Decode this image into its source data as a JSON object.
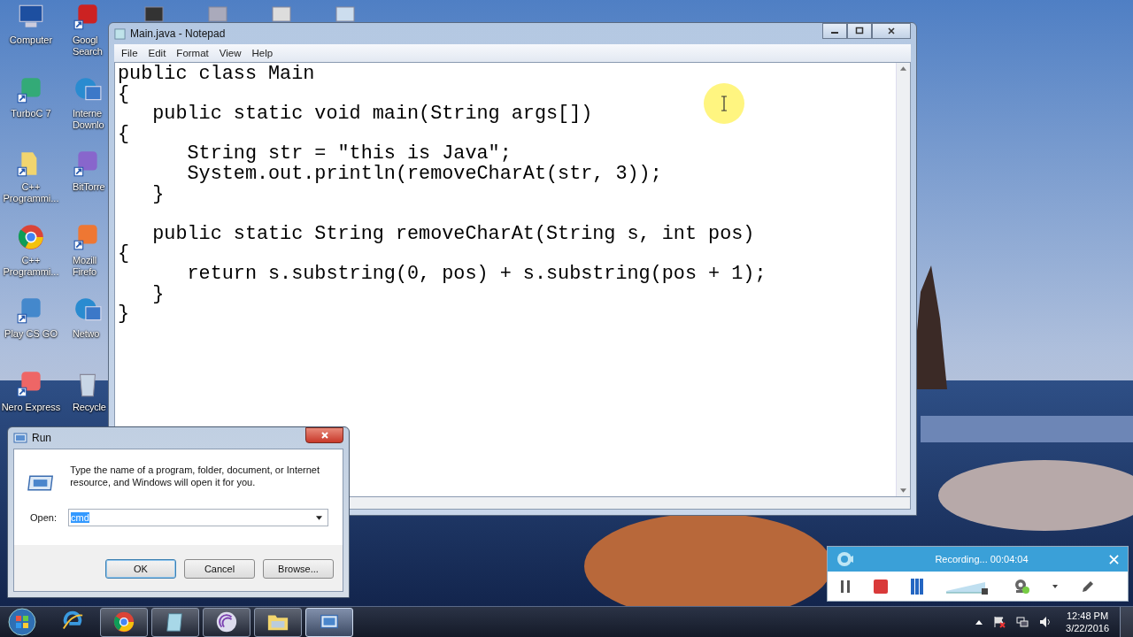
{
  "desktop_icons": [
    {
      "label": "Computer"
    },
    {
      "label": "TurboC 7"
    },
    {
      "label": "C++ Programmi..."
    },
    {
      "label": "C++ Programmi..."
    },
    {
      "label": "Play CS GO"
    },
    {
      "label": "Nero Express"
    },
    {
      "label": "Googl Search"
    },
    {
      "label": "Interne Downlo"
    },
    {
      "label": "BitTorre"
    },
    {
      "label": "Mozill Firefo"
    },
    {
      "label": "Netwo"
    },
    {
      "label": "Recycle"
    }
  ],
  "notepad": {
    "title": "Main.java - Notepad",
    "menu": [
      "File",
      "Edit",
      "Format",
      "View",
      "Help"
    ],
    "code_blocks": [
      [
        "public class Main",
        "{",
        "   public static void main(String args[])",
        "{",
        "      String str = \"this is Java\";",
        "      System.out.println(removeCharAt(str, 3));",
        "   }"
      ],
      [
        "   public static String removeCharAt(String s, int pos)",
        "{",
        "      return s.substring(0, pos) + s.substring(pos + 1);",
        "   }",
        "}"
      ]
    ]
  },
  "run_dialog": {
    "title": "Run",
    "description": "Type the name of a program, folder, document, or Internet resource, and Windows will open it for you.",
    "open_label": "Open:",
    "open_value": "cmd",
    "text_selected": true,
    "buttons": [
      {
        "label": "OK",
        "default": true
      },
      {
        "label": "Cancel",
        "default": false
      },
      {
        "label": "Browse...",
        "default": false
      }
    ]
  },
  "recorder": {
    "status": "Recording... 00:04:04"
  },
  "taskbar": {
    "items": [
      {
        "open": false,
        "selected": false
      },
      {
        "open": true,
        "selected": false
      },
      {
        "open": true,
        "selected": false
      },
      {
        "open": true,
        "selected": false
      },
      {
        "open": true,
        "selected": false
      },
      {
        "open": true,
        "selected": true
      }
    ],
    "time": "12:48 PM",
    "date": "3/22/2016"
  }
}
